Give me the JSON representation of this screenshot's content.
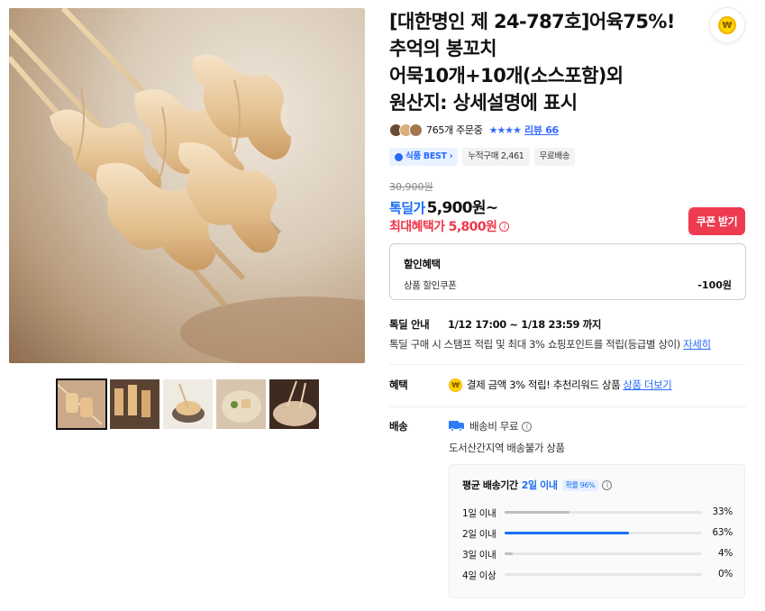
{
  "product": {
    "title_lines": [
      "[대한명인 제 24-787호]어육75%!",
      "추억의 봉꼬치",
      "어묵10개+10개(소스포함)외",
      "원산지: 상세설명에 표시"
    ]
  },
  "rating": {
    "orders": "765개 주문중",
    "stars": "★★★★",
    "review_link": "리뷰 66"
  },
  "badges": [
    {
      "label": "식품 BEST",
      "icon": "shield-icon"
    },
    {
      "label": "누적구매 2,461"
    },
    {
      "label": "무료배송"
    }
  ],
  "price": {
    "original": "30,900원",
    "deal_label": "톡딜가",
    "deal_value": "5,900원~",
    "max_benefit": "최대혜택가 5,800원",
    "coupon_button": "쿠폰 받기"
  },
  "discount": {
    "heading": "할인혜택",
    "coupon_label": "상품 할인쿠폰",
    "coupon_value": "-100원"
  },
  "special_deal": {
    "label": "톡딜 안내",
    "period": "1/12 17:00 ~ 1/18 23:59 까지",
    "description": "톡딜 구매 시 스탬프 적립 및 최대 3% 쇼핑포인트를 적립(등급별 상이)",
    "detail_link": "자세히"
  },
  "benefit": {
    "label": "혜택",
    "coin_symbol": "₩",
    "text": "결제 금액 3% 적립! 추천리워드 상품",
    "link": "상품 더보기"
  },
  "shipping": {
    "label": "배송",
    "fee": "배송비 무료",
    "note": "도서산간지역 배송불가 상품",
    "avg_title": "평균 배송기간",
    "avg_value": "2일 이내",
    "avg_prob": "확률 96%",
    "rows": [
      {
        "label": "1일 이내",
        "pct": "33%",
        "value": 0.33,
        "highlight": false
      },
      {
        "label": "2일 이내",
        "pct": "63%",
        "value": 0.63,
        "highlight": true
      },
      {
        "label": "3일 이내",
        "pct": "4%",
        "value": 0.04,
        "highlight": false
      },
      {
        "label": "4일 이상",
        "pct": "0%",
        "value": 0.0,
        "highlight": false
      }
    ]
  },
  "favorite": {
    "coin_symbol": "₩"
  },
  "colors": {
    "accent_blue": "#1b6ff5",
    "accent_red": "#f0374c"
  }
}
